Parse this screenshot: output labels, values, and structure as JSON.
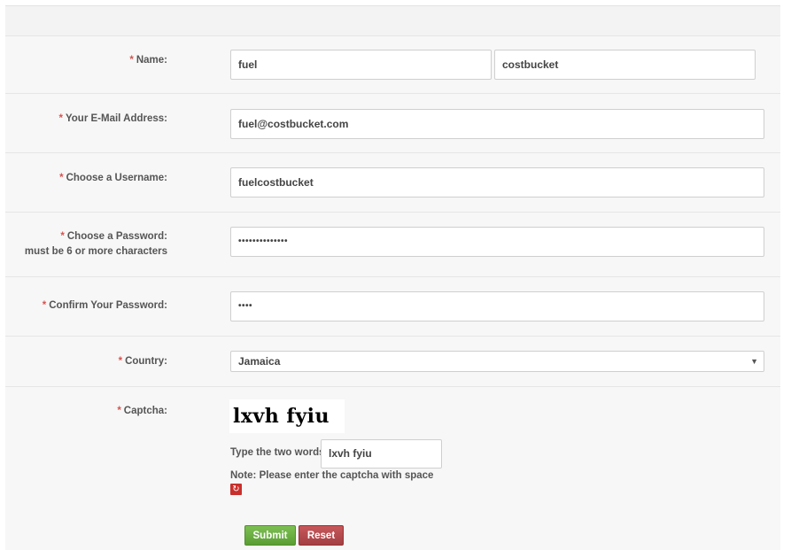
{
  "form": {
    "name": {
      "label": "Name:",
      "first_value": "fuel",
      "last_value": "costbucket"
    },
    "email": {
      "label": "Your E-Mail Address:",
      "value": "fuel@costbucket.com"
    },
    "username": {
      "label": "Choose a Username:",
      "value": "fuelcostbucket"
    },
    "password": {
      "label": "Choose a Password:",
      "hint": "must be 6 or more characters",
      "value": "••••••••••••••"
    },
    "confirm": {
      "label": "Confirm Your Password:",
      "value": "••••"
    },
    "country": {
      "label": "Country:",
      "value": "Jamaica",
      "caret": "▼"
    },
    "captcha": {
      "label": "Captcha:",
      "image_text": "lxvh fyiu",
      "prompt": "Type the two words:",
      "value": "lxvh fyiu",
      "note": "Note: Please enter the captcha with space",
      "refresh_glyph": "↻"
    },
    "required_mark": "*",
    "submit_label": "Submit",
    "reset_label": "Reset"
  }
}
